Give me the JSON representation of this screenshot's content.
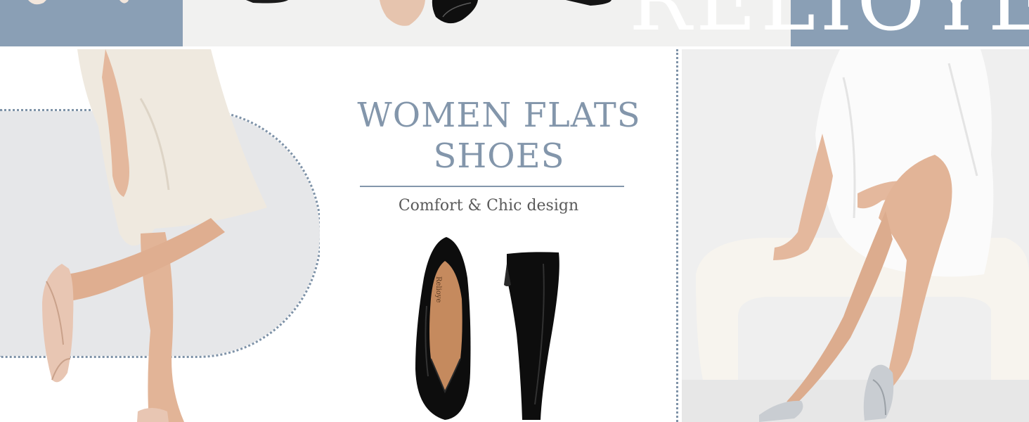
{
  "brand": {
    "wordmark": "RELIOYE",
    "insole_mark": "Relioye"
  },
  "headline": {
    "line1": "WOMEN FLATS",
    "line2": "SHOES"
  },
  "tagline": "Comfort & Chic design",
  "colors": {
    "accent": "#8a9fb5",
    "title": "#8396ab",
    "text": "#5a5a5a",
    "patent_black": "#0d0d0d",
    "nude": "#e8c6b3",
    "silver": "#c9cdd2"
  }
}
